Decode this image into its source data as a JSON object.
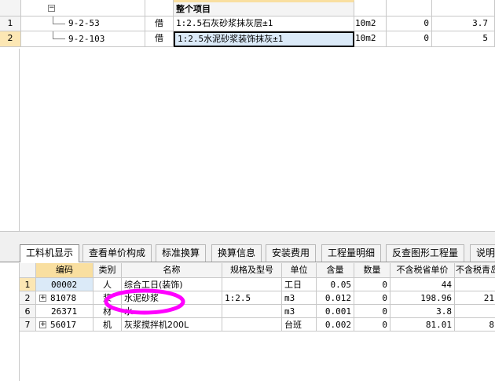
{
  "top_grid": {
    "group_title": "整个项目",
    "rows": [
      {
        "num": "1",
        "code": "9-2-53",
        "type": "借",
        "name": "1:2.5石灰砂浆抹灰层±1",
        "unit": "10m2",
        "qty": "0",
        "price": "3.7"
      },
      {
        "num": "2",
        "code": "9-2-103",
        "type": "借",
        "name": "1:2.5水泥砂浆装饰抹灰±1",
        "unit": "10m2",
        "qty": "0",
        "price": "5"
      }
    ]
  },
  "tabs": [
    "工料机显示",
    "查看单价构成",
    "标准换算",
    "换算信息",
    "安装费用",
    "工程量明细",
    "反查图形工程量",
    "说明信息"
  ],
  "bottom_grid": {
    "headers": [
      "编码",
      "类别",
      "名称",
      "规格及型号",
      "单位",
      "含量",
      "数量",
      "不含税省单价",
      "不含税青岛"
    ],
    "rows": [
      {
        "num": "1",
        "expand": false,
        "code": "00002",
        "type": "人",
        "name": "综合工日(装饰)",
        "spec": "",
        "unit": "工日",
        "content": "0.05",
        "qty": "0",
        "price": "44",
        "price2": ""
      },
      {
        "num": "2",
        "expand": true,
        "code": "81078",
        "type": "浆",
        "name": "水泥砂浆",
        "spec": "1:2.5",
        "unit": "m3",
        "content": "0.012",
        "qty": "0",
        "price": "198.96",
        "price2": "21"
      },
      {
        "num": "6",
        "expand": false,
        "code": "26371",
        "type": "材",
        "name": "水",
        "spec": "",
        "unit": "m3",
        "content": "0.001",
        "qty": "0",
        "price": "3.8",
        "price2": ""
      },
      {
        "num": "7",
        "expand": true,
        "code": "56017",
        "type": "机",
        "name": "灰浆搅拌机200L",
        "spec": "",
        "unit": "台班",
        "content": "0.002",
        "qty": "0",
        "price": "81.01",
        "price2": "8"
      }
    ]
  },
  "colors": {
    "selected_row": "#fce7b4",
    "header_highlight": "#f9dfa0",
    "editing_cell": "#dbeaf8",
    "annotation": "#ff00ff"
  }
}
